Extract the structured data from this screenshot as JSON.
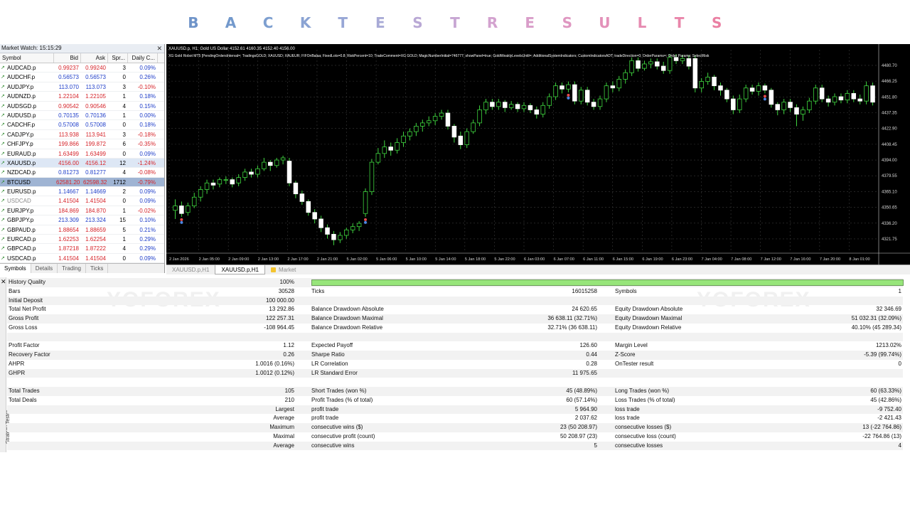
{
  "banner": {
    "letters": [
      "B",
      "A",
      "C",
      "K",
      "T",
      "E",
      "S",
      "T",
      "R",
      "E",
      "S",
      "U",
      "L",
      "T",
      "S"
    ],
    "colors": [
      "#6f94c9",
      "#7399cc",
      "#7d9fd0",
      "#8aa3d3",
      "#98a7d6",
      "#a8aad6",
      "#b9a8d5",
      "#c7a6d3",
      "#d3a2cf",
      "#d99dc9",
      "#df97c1",
      "#e391b9",
      "#e68bb1",
      "#e986aa",
      "#ea80a3"
    ]
  },
  "market_watch": {
    "title": "Market Watch: 15:15:29",
    "columns": [
      "Symbol",
      "Bid",
      "Ask",
      "Spr...",
      "Daily C..."
    ],
    "rows": [
      {
        "symbol": "AUDCAD.p",
        "bid": "0.99237",
        "ask": "0.99240",
        "spread": "3",
        "change": "0.09%",
        "dir": "down"
      },
      {
        "symbol": "AUDCHF.p",
        "bid": "0.56573",
        "ask": "0.56573",
        "spread": "0",
        "change": "0.26%",
        "dir": "up"
      },
      {
        "symbol": "AUDJPY.p",
        "bid": "113.070",
        "ask": "113.073",
        "spread": "3",
        "change": "-0.10%",
        "dir": "up"
      },
      {
        "symbol": "AUDNZD.p",
        "bid": "1.22104",
        "ask": "1.22105",
        "spread": "1",
        "change": "0.18%",
        "dir": "down"
      },
      {
        "symbol": "AUDSGD.p",
        "bid": "0.90542",
        "ask": "0.90546",
        "spread": "4",
        "change": "0.15%",
        "dir": "down"
      },
      {
        "symbol": "AUDUSD.p",
        "bid": "0.70135",
        "ask": "0.70136",
        "spread": "1",
        "change": "0.00%",
        "dir": "up"
      },
      {
        "symbol": "CADCHF.p",
        "bid": "0.57008",
        "ask": "0.57008",
        "spread": "0",
        "change": "0.18%",
        "dir": "up"
      },
      {
        "symbol": "CADJPY.p",
        "bid": "113.938",
        "ask": "113.941",
        "spread": "3",
        "change": "-0.18%",
        "dir": "down"
      },
      {
        "symbol": "CHFJPY.p",
        "bid": "199.866",
        "ask": "199.872",
        "spread": "6",
        "change": "-0.35%",
        "dir": "down"
      },
      {
        "symbol": "EURAUD.p",
        "bid": "1.63499",
        "ask": "1.63499",
        "spread": "0",
        "change": "0.09%",
        "dir": "down"
      },
      {
        "symbol": "XAUUSD.p",
        "bid": "4156.00",
        "ask": "4156.12",
        "spread": "12",
        "change": "-1.24%",
        "dir": "down"
      },
      {
        "symbol": "NZDCAD.p",
        "bid": "0.81273",
        "ask": "0.81277",
        "spread": "4",
        "change": "-0.08%",
        "dir": "up"
      },
      {
        "symbol": "BTCUSD",
        "bid": "62581.20",
        "ask": "62598.32",
        "spread": "1712",
        "change": "-0.79%",
        "dir": "down"
      },
      {
        "symbol": "EURUSD.p",
        "bid": "1.14667",
        "ask": "1.14669",
        "spread": "2",
        "change": "0.09%",
        "dir": "up"
      },
      {
        "symbol": "USDCAD",
        "bid": "1.41504",
        "ask": "1.41504",
        "spread": "0",
        "change": "0.09%",
        "dir": "down"
      },
      {
        "symbol": "EURJPY.p",
        "bid": "184.869",
        "ask": "184.870",
        "spread": "1",
        "change": "-0.02%",
        "dir": "down"
      },
      {
        "symbol": "GBPJPY.p",
        "bid": "213.309",
        "ask": "213.324",
        "spread": "15",
        "change": "0.10%",
        "dir": "up"
      },
      {
        "symbol": "GBPAUD.p",
        "bid": "1.88654",
        "ask": "1.88659",
        "spread": "5",
        "change": "0.21%",
        "dir": "down"
      },
      {
        "symbol": "EURCAD.p",
        "bid": "1.62253",
        "ask": "1.62254",
        "spread": "1",
        "change": "0.29%",
        "dir": "down"
      },
      {
        "symbol": "GBPCAD.p",
        "bid": "1.87218",
        "ask": "1.87222",
        "spread": "4",
        "change": "0.29%",
        "dir": "down"
      },
      {
        "symbol": "USDCAD.p",
        "bid": "1.41504",
        "ask": "1.41504",
        "spread": "0",
        "change": "0.09%",
        "dir": "down"
      }
    ],
    "tabs": [
      "Symbols",
      "Details",
      "Trading",
      "Ticks"
    ]
  },
  "chart": {
    "header": "XAUUSD.p, H1:  Gold US Dollar  4152.61 4160.35 4152.40 4156.00",
    "sub": "XG Gold Robot MT5 [PendingOrdersInterval=; TradingsGOLD; XAUUSD; XAUEUR; FIFOnBalaa; FixedLots=0.8; RiskPercent=10; TradeComment=XG GOLD; MagicNumberInitial=746777; showPanel=true; GoldWeaklyLevelsUntil=; AdditionalSystemIndicators; CustomIndicatorsADT; tradeDirection=0; OrderParams=; Order Params; SelectRisk",
    "price_labels": [
      "4480.70",
      "4466.25",
      "4451.80",
      "4437.35",
      "4422.90",
      "4408.45",
      "4394.00",
      "4379.55",
      "4365.10",
      "4350.65",
      "4336.20",
      "4321.75"
    ],
    "time_labels": [
      "2 Jan 2026",
      "2 Jan 05:00",
      "2 Jan 09:00",
      "2 Jan 13:00",
      "2 Jan 17:00",
      "2 Jan 21:00",
      "5 Jan 02:00",
      "5 Jan 06:00",
      "5 Jan 10:00",
      "5 Jan 14:00",
      "5 Jan 18:00",
      "5 Jan 22:00",
      "6 Jan 03:00",
      "6 Jan 07:00",
      "6 Jan 11:00",
      "6 Jan 15:00",
      "6 Jan 19:00",
      "6 Jan 23:00",
      "7 Jan 04:00",
      "7 Jan 08:00",
      "7 Jan 12:00",
      "7 Jan 16:00",
      "7 Jan 20:00",
      "8 Jan 01:00"
    ],
    "tabs": [
      "XAUUSD.p,H1",
      "XAUUSD.p,H1",
      "Market"
    ],
    "active_tab": 1
  },
  "chart_data": {
    "type": "candlestick",
    "symbol": "XAUUSD.p",
    "timeframe": "H1",
    "ylim": [
      4310,
      4495
    ],
    "grid": true,
    "series": [
      {
        "o": 4348,
        "c": 4352,
        "h": 4358,
        "l": 4340
      },
      {
        "o": 4352,
        "c": 4345,
        "h": 4356,
        "l": 4342
      },
      {
        "o": 4346,
        "c": 4352,
        "h": 4355,
        "l": 4343
      },
      {
        "o": 4352,
        "c": 4360,
        "h": 4364,
        "l": 4350
      },
      {
        "o": 4360,
        "c": 4367,
        "h": 4370,
        "l": 4356
      },
      {
        "o": 4367,
        "c": 4373,
        "h": 4376,
        "l": 4363
      },
      {
        "o": 4373,
        "c": 4371,
        "h": 4376,
        "l": 4367
      },
      {
        "o": 4372,
        "c": 4376,
        "h": 4378,
        "l": 4369
      },
      {
        "o": 4376,
        "c": 4376,
        "h": 4379,
        "l": 4372
      },
      {
        "o": 4376,
        "c": 4372,
        "h": 4378,
        "l": 4369
      },
      {
        "o": 4373,
        "c": 4378,
        "h": 4381,
        "l": 4370
      },
      {
        "o": 4378,
        "c": 4383,
        "h": 4386,
        "l": 4375
      },
      {
        "o": 4383,
        "c": 4381,
        "h": 4386,
        "l": 4378
      },
      {
        "o": 4381,
        "c": 4386,
        "h": 4389,
        "l": 4378
      },
      {
        "o": 4386,
        "c": 4392,
        "h": 4396,
        "l": 4384
      },
      {
        "o": 4392,
        "c": 4389,
        "h": 4394,
        "l": 4384
      },
      {
        "o": 4389,
        "c": 4394,
        "h": 4396,
        "l": 4387
      },
      {
        "o": 4394,
        "c": 4396,
        "h": 4398,
        "l": 4390
      },
      {
        "o": 4393,
        "c": 4373,
        "h": 4396,
        "l": 4370
      },
      {
        "o": 4373,
        "c": 4363,
        "h": 4375,
        "l": 4359
      },
      {
        "o": 4363,
        "c": 4356,
        "h": 4366,
        "l": 4353
      },
      {
        "o": 4356,
        "c": 4346,
        "h": 4358,
        "l": 4343
      },
      {
        "o": 4346,
        "c": 4340,
        "h": 4349,
        "l": 4336
      },
      {
        "o": 4340,
        "c": 4332,
        "h": 4343,
        "l": 4328
      },
      {
        "o": 4332,
        "c": 4326,
        "h": 4335,
        "l": 4322
      },
      {
        "o": 4326,
        "c": 4321,
        "h": 4329,
        "l": 4316
      },
      {
        "o": 4321,
        "c": 4325,
        "h": 4328,
        "l": 4318
      },
      {
        "o": 4325,
        "c": 4330,
        "h": 4332,
        "l": 4322
      },
      {
        "o": 4330,
        "c": 4333,
        "h": 4336,
        "l": 4327
      },
      {
        "o": 4333,
        "c": 4336,
        "h": 4338,
        "l": 4329
      },
      {
        "o": 4345,
        "c": 4365,
        "h": 4368,
        "l": 4342
      },
      {
        "o": 4365,
        "c": 4392,
        "h": 4395,
        "l": 4362
      },
      {
        "o": 4392,
        "c": 4400,
        "h": 4405,
        "l": 4390
      },
      {
        "o": 4400,
        "c": 4406,
        "h": 4412,
        "l": 4396
      },
      {
        "o": 4406,
        "c": 4403,
        "h": 4410,
        "l": 4398
      },
      {
        "o": 4403,
        "c": 4410,
        "h": 4414,
        "l": 4400
      },
      {
        "o": 4410,
        "c": 4416,
        "h": 4420,
        "l": 4406
      },
      {
        "o": 4416,
        "c": 4420,
        "h": 4423,
        "l": 4412
      },
      {
        "o": 4420,
        "c": 4425,
        "h": 4428,
        "l": 4416
      },
      {
        "o": 4425,
        "c": 4428,
        "h": 4431,
        "l": 4420
      },
      {
        "o": 4428,
        "c": 4430,
        "h": 4434,
        "l": 4425
      },
      {
        "o": 4430,
        "c": 4434,
        "h": 4437,
        "l": 4426
      },
      {
        "o": 4434,
        "c": 4437,
        "h": 4440,
        "l": 4431
      },
      {
        "o": 4437,
        "c": 4425,
        "h": 4440,
        "l": 4422
      },
      {
        "o": 4425,
        "c": 4415,
        "h": 4427,
        "l": 4410
      },
      {
        "o": 4416,
        "c": 4408,
        "h": 4420,
        "l": 4404
      },
      {
        "o": 4408,
        "c": 4420,
        "h": 4423,
        "l": 4405
      },
      {
        "o": 4420,
        "c": 4428,
        "h": 4431,
        "l": 4418
      },
      {
        "o": 4428,
        "c": 4440,
        "h": 4444,
        "l": 4425
      },
      {
        "o": 4440,
        "c": 4447,
        "h": 4450,
        "l": 4436
      },
      {
        "o": 4447,
        "c": 4443,
        "h": 4450,
        "l": 4440
      },
      {
        "o": 4443,
        "c": 4447,
        "h": 4450,
        "l": 4440
      },
      {
        "o": 4447,
        "c": 4442,
        "h": 4449,
        "l": 4438
      },
      {
        "o": 4442,
        "c": 4445,
        "h": 4448,
        "l": 4440
      },
      {
        "o": 4445,
        "c": 4441,
        "h": 4447,
        "l": 4438
      },
      {
        "o": 4441,
        "c": 4444,
        "h": 4447,
        "l": 4438
      },
      {
        "o": 4444,
        "c": 4440,
        "h": 4446,
        "l": 4437
      },
      {
        "o": 4440,
        "c": 4436,
        "h": 4443,
        "l": 4432
      },
      {
        "o": 4436,
        "c": 4444,
        "h": 4447,
        "l": 4433
      },
      {
        "o": 4444,
        "c": 4452,
        "h": 4455,
        "l": 4441
      },
      {
        "o": 4452,
        "c": 4462,
        "h": 4465,
        "l": 4449
      },
      {
        "o": 4462,
        "c": 4459,
        "h": 4465,
        "l": 4455
      },
      {
        "o": 4459,
        "c": 4463,
        "h": 4466,
        "l": 4456
      },
      {
        "o": 4463,
        "c": 4448,
        "h": 4466,
        "l": 4445
      },
      {
        "o": 4448,
        "c": 4458,
        "h": 4461,
        "l": 4445
      },
      {
        "o": 4458,
        "c": 4447,
        "h": 4461,
        "l": 4444
      },
      {
        "o": 4447,
        "c": 4443,
        "h": 4450,
        "l": 4440
      },
      {
        "o": 4443,
        "c": 4450,
        "h": 4453,
        "l": 4440
      },
      {
        "o": 4450,
        "c": 4462,
        "h": 4465,
        "l": 4447
      },
      {
        "o": 4462,
        "c": 4460,
        "h": 4466,
        "l": 4456
      },
      {
        "o": 4460,
        "c": 4468,
        "h": 4471,
        "l": 4457
      },
      {
        "o": 4468,
        "c": 4474,
        "h": 4477,
        "l": 4464
      },
      {
        "o": 4474,
        "c": 4485,
        "h": 4488,
        "l": 4471
      },
      {
        "o": 4485,
        "c": 4478,
        "h": 4488,
        "l": 4475
      },
      {
        "o": 4478,
        "c": 4482,
        "h": 4485,
        "l": 4476
      },
      {
        "o": 4482,
        "c": 4484,
        "h": 4487,
        "l": 4478
      },
      {
        "o": 4484,
        "c": 4480,
        "h": 4487,
        "l": 4477
      },
      {
        "o": 4480,
        "c": 4476,
        "h": 4484,
        "l": 4473
      },
      {
        "o": 4476,
        "c": 4488,
        "h": 4491,
        "l": 4473
      },
      {
        "o": 4488,
        "c": 4485,
        "h": 4491,
        "l": 4482
      },
      {
        "o": 4485,
        "c": 4487,
        "h": 4490,
        "l": 4482
      },
      {
        "o": 4487,
        "c": 4480,
        "h": 4490,
        "l": 4477
      },
      {
        "o": 4487,
        "c": 4460,
        "h": 4490,
        "l": 4456
      },
      {
        "o": 4460,
        "c": 4466,
        "h": 4469,
        "l": 4456
      },
      {
        "o": 4466,
        "c": 4470,
        "h": 4474,
        "l": 4463
      },
      {
        "o": 4470,
        "c": 4462,
        "h": 4472,
        "l": 4458
      },
      {
        "o": 4462,
        "c": 4458,
        "h": 4465,
        "l": 4453
      },
      {
        "o": 4458,
        "c": 4450,
        "h": 4460,
        "l": 4447
      },
      {
        "o": 4450,
        "c": 4440,
        "h": 4453,
        "l": 4436
      },
      {
        "o": 4440,
        "c": 4450,
        "h": 4454,
        "l": 4437
      },
      {
        "o": 4450,
        "c": 4460,
        "h": 4463,
        "l": 4447
      },
      {
        "o": 4460,
        "c": 4457,
        "h": 4463,
        "l": 4454
      },
      {
        "o": 4457,
        "c": 4462,
        "h": 4465,
        "l": 4453
      },
      {
        "o": 4462,
        "c": 4458,
        "h": 4464,
        "l": 4455
      },
      {
        "o": 4458,
        "c": 4445,
        "h": 4460,
        "l": 4442
      },
      {
        "o": 4445,
        "c": 4440,
        "h": 4447,
        "l": 4435
      },
      {
        "o": 4440,
        "c": 4447,
        "h": 4450,
        "l": 4436
      },
      {
        "o": 4447,
        "c": 4442,
        "h": 4450,
        "l": 4438
      },
      {
        "o": 4442,
        "c": 4436,
        "h": 4445,
        "l": 4425
      },
      {
        "o": 4436,
        "c": 4440,
        "h": 4443,
        "l": 4430
      },
      {
        "o": 4440,
        "c": 4448,
        "h": 4451,
        "l": 4437
      },
      {
        "o": 4448,
        "c": 4460,
        "h": 4463,
        "l": 4445
      },
      {
        "o": 4460,
        "c": 4450,
        "h": 4463,
        "l": 4447
      },
      {
        "o": 4450,
        "c": 4447,
        "h": 4453,
        "l": 4443
      },
      {
        "o": 4447,
        "c": 4452,
        "h": 4455,
        "l": 4444
      },
      {
        "o": 4452,
        "c": 4449,
        "h": 4455,
        "l": 4446
      },
      {
        "o": 4449,
        "c": 4455,
        "h": 4458,
        "l": 4446
      },
      {
        "o": 4455,
        "c": 4450,
        "h": 4458,
        "l": 4447
      },
      {
        "o": 4450,
        "c": 4448,
        "h": 4454,
        "l": 4445
      },
      {
        "o": 4448,
        "c": 4462,
        "h": 4466,
        "l": 4445
      },
      {
        "o": 4462,
        "c": 4447,
        "h": 4465,
        "l": 4444
      }
    ]
  },
  "report": {
    "vertical_label": "Strategy Tester",
    "rows": [
      {
        "l1": "History Quality",
        "v1": "100%",
        "bar": true,
        "shade": true
      },
      {
        "l1": "Bars",
        "v1": "30528",
        "l2": "Ticks",
        "v2": "16015258",
        "l3": "Symbols",
        "v3": "1"
      },
      {
        "l1": "Initial Deposit",
        "v1": "100 000.00",
        "shade": true
      },
      {
        "l1": "Total Net Profit",
        "v1": "13 292.86",
        "l2": "Balance Drawdown Absolute",
        "v2": "24 620.65",
        "l3": "Equity Drawdown Absolute",
        "v3": "32 346.69"
      },
      {
        "l1": "Gross Profit",
        "v1": "122 257.31",
        "l2": "Balance Drawdown Maximal",
        "v2": "36 638.11 (32.71%)",
        "l3": "Equity Drawdown Maximal",
        "v3": "51 032.31 (32.09%)",
        "shade": true
      },
      {
        "l1": "Gross Loss",
        "v1": "-108 964.45",
        "l2": "Balance Drawdown Relative",
        "v2": "32.71% (36 638.11)",
        "l3": "Equity Drawdown Relative",
        "v3": "40.10% (45 289.34)"
      },
      {
        "l1": "",
        "v1": "",
        "shade": true
      },
      {
        "l1": "Profit Factor",
        "v1": "1.12",
        "l2": "Expected Payoff",
        "v2": "126.60",
        "l3": "Margin Level",
        "v3": "1213.02%"
      },
      {
        "l1": "Recovery Factor",
        "v1": "0.26",
        "l2": "Sharpe Ratio",
        "v2": "0.44",
        "l3": "Z-Score",
        "v3": "-5.39 (99.74%)",
        "shade": true
      },
      {
        "l1": "AHPR",
        "v1": "1.0016 (0.16%)",
        "l2": "LR Correlation",
        "v2": "0.28",
        "l3": "OnTester result",
        "v3": "0"
      },
      {
        "l1": "GHPR",
        "v1": "1.0012 (0.12%)",
        "l2": "LR Standard Error",
        "v2": "11 975.65",
        "shade": true
      },
      {
        "l1": "",
        "v1": ""
      },
      {
        "l1": "Total Trades",
        "v1": "105",
        "l2": "Short Trades (won %)",
        "v2": "45 (48.89%)",
        "l3": "Long Trades (won %)",
        "v3": "60 (63.33%)",
        "shade": true
      },
      {
        "l1": "Total Deals",
        "v1": "210",
        "l2": "Profit Trades (% of total)",
        "v2": "60 (57.14%)",
        "l3": "Loss Trades (% of total)",
        "v3": "45 (42.86%)"
      },
      {
        "v1": "Largest",
        "l2": "profit trade",
        "v2": "5 964.90",
        "l3": "loss trade",
        "v3": "-9 752.40",
        "shade": true
      },
      {
        "v1": "Average",
        "l2": "profit trade",
        "v2": "2 037.62",
        "l3": "loss trade",
        "v3": "-2 421.43"
      },
      {
        "v1": "Maximum",
        "l2": "consecutive wins ($)",
        "v2": "23 (50 208.97)",
        "l3": "consecutive losses ($)",
        "v3": "13 (-22 764.86)",
        "shade": true
      },
      {
        "v1": "Maximal",
        "l2": "consecutive profit (count)",
        "v2": "50 208.97 (23)",
        "l3": "consecutive loss (count)",
        "v3": "-22 764.86 (13)"
      },
      {
        "v1": "Average",
        "l2": "consecutive wins",
        "v2": "5",
        "l3": "consecutive losses",
        "v3": "4",
        "shade": true
      }
    ],
    "watermark": "YOFOREX"
  }
}
